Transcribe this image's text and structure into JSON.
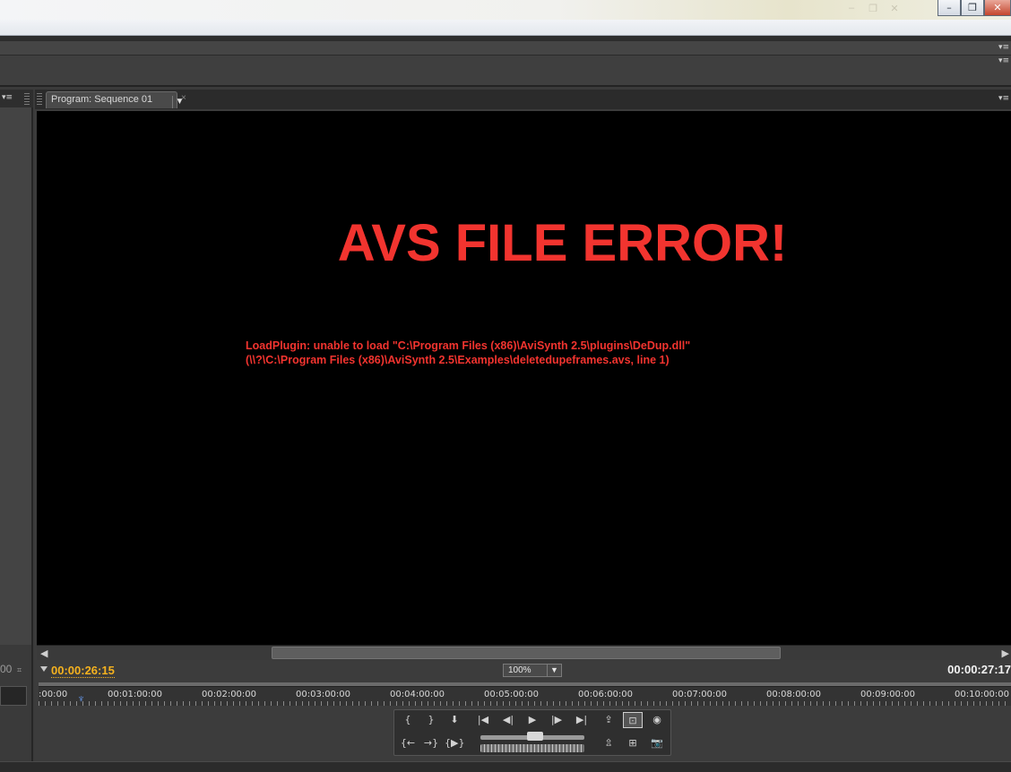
{
  "window": {
    "minimize_glyph": "–",
    "restore_glyph": "❐",
    "close_glyph": "✕",
    "ghost_icons": [
      "–",
      "❐",
      "✕"
    ]
  },
  "left_panel": {
    "timecode_fragment": "00",
    "menu_glyph": "▾≡"
  },
  "monitor": {
    "tab_label": "Program: Sequence 01",
    "tab_dropdown_glyph": "▼",
    "tab_close_glyph": "×",
    "menu_glyph": "▾≡",
    "error": {
      "title": "AVS FILE ERROR!",
      "line1": "LoadPlugin: unable to load \"C:\\Program Files (x86)\\AviSynth 2.5\\plugins\\DeDup.dll\"",
      "line2": "(\\\\?\\C:\\Program Files (x86)\\AviSynth 2.5\\Examples\\deletedupeframes.avs, line 1)"
    },
    "current_timecode": "00:00:26:15",
    "zoom_level": "100%",
    "duration_timecode": "00:00:27:17",
    "ruler_labels": [
      ":00:00",
      "00:01:00:00",
      "00:02:00:00",
      "00:03:00:00",
      "00:04:00:00",
      "00:05:00:00",
      "00:06:00:00",
      "00:07:00:00",
      "00:08:00:00",
      "00:09:00:00",
      "00:10:00:00"
    ],
    "transport": {
      "mark_in": "{",
      "mark_out": "}",
      "set_marker": "⬇",
      "go_to_in": "{←",
      "go_to_out": "→}",
      "play_in_to_out": "{▶}",
      "step_back": "◀|",
      "play": "▶",
      "step_forward": "|▶",
      "go_to_prev_edit": "|◀",
      "go_to_next_edit": "▶|",
      "lift": "⇪",
      "extract": "⇫",
      "safe_margins": "⊡",
      "output": "◉",
      "export_frame": "📷",
      "trim_monitor": "⊞"
    },
    "colors": {
      "error_red": "#f2342f",
      "timecode_yellow": "#f5b21f"
    }
  }
}
